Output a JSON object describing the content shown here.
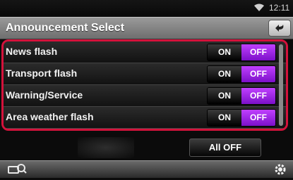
{
  "status_bar": {
    "time": "12:11",
    "wifi_icon": "wifi-icon"
  },
  "header": {
    "title": "Announcement Select",
    "back_icon": "back-arrow-icon"
  },
  "announcements": [
    {
      "label": "News flash",
      "on_label": "ON",
      "off_label": "OFF",
      "selected": "OFF"
    },
    {
      "label": "Transport flash",
      "on_label": "ON",
      "off_label": "OFF",
      "selected": "OFF"
    },
    {
      "label": "Warning/Service",
      "on_label": "ON",
      "off_label": "OFF",
      "selected": "OFF"
    },
    {
      "label": "Area weather flash",
      "on_label": "ON",
      "off_label": "OFF",
      "selected": "OFF"
    }
  ],
  "actions": {
    "all_off_label": "All OFF"
  },
  "footer": {
    "left_icon": "source-search-icon",
    "right_icon": "gear-icon"
  },
  "colors": {
    "highlight_frame": "#d4123b",
    "selected_toggle": "#a02ee8"
  }
}
